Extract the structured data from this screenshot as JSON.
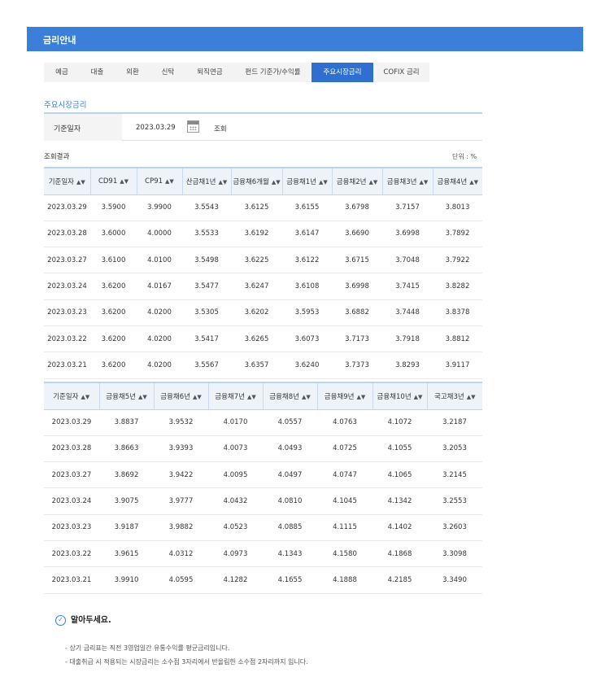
{
  "page": {
    "title": "금리안내"
  },
  "tabs": [
    {
      "label": "예금",
      "active": false
    },
    {
      "label": "대출",
      "active": false
    },
    {
      "label": "외환",
      "active": false
    },
    {
      "label": "신탁",
      "active": false
    },
    {
      "label": "퇴직연금",
      "active": false
    },
    {
      "label": "펀드 기준가/수익률",
      "active": false
    },
    {
      "label": "주요시장금리",
      "active": true
    },
    {
      "label": "COFIX 금리",
      "active": false
    }
  ],
  "section": {
    "title": "주요시장금리"
  },
  "search": {
    "label": "기준일자",
    "date": "2023.03.29",
    "button": "조회"
  },
  "result": {
    "label": "조회결과",
    "unit": "단위 : %"
  },
  "table1": {
    "headers": [
      "기준일자",
      "CD91",
      "CP91",
      "산금채1년",
      "금융채6개월",
      "금융채1년",
      "금융채2년",
      "금융채3년",
      "금융채4년"
    ],
    "rows": [
      [
        "2023.03.29",
        "3.5900",
        "3.9900",
        "3.5543",
        "3.6125",
        "3.6155",
        "3.6798",
        "3.7157",
        "3.8013"
      ],
      [
        "2023.03.28",
        "3.6000",
        "4.0000",
        "3.5533",
        "3.6192",
        "3.6147",
        "3.6690",
        "3.6998",
        "3.7892"
      ],
      [
        "2023.03.27",
        "3.6100",
        "4.0100",
        "3.5498",
        "3.6225",
        "3.6122",
        "3.6715",
        "3.7048",
        "3.7922"
      ],
      [
        "2023.03.24",
        "3.6200",
        "4.0167",
        "3.5477",
        "3.6247",
        "3.6108",
        "3.6998",
        "3.7415",
        "3.8282"
      ],
      [
        "2023.03.23",
        "3.6200",
        "4.0200",
        "3.5305",
        "3.6202",
        "3.5953",
        "3.6882",
        "3.7448",
        "3.8378"
      ],
      [
        "2023.03.22",
        "3.6200",
        "4.0200",
        "3.5417",
        "3.6265",
        "3.6073",
        "3.7173",
        "3.7918",
        "3.8812"
      ],
      [
        "2023.03.21",
        "3.6200",
        "4.0200",
        "3.5567",
        "3.6357",
        "3.6240",
        "3.7373",
        "3.8293",
        "3.9117"
      ]
    ]
  },
  "table2": {
    "headers": [
      "기준일자",
      "금융채5년",
      "금융채6년",
      "금융채7년",
      "금융채8년",
      "금융채9년",
      "금융채10년",
      "국고채3년"
    ],
    "rows": [
      [
        "2023.03.29",
        "3.8837",
        "3.9532",
        "4.0170",
        "4.0557",
        "4.0763",
        "4.1072",
        "3.2187"
      ],
      [
        "2023.03.28",
        "3.8663",
        "3.9393",
        "4.0073",
        "4.0493",
        "4.0725",
        "4.1055",
        "3.2053"
      ],
      [
        "2023.03.27",
        "3.8692",
        "3.9422",
        "4.0095",
        "4.0497",
        "4.0747",
        "4.1065",
        "3.2145"
      ],
      [
        "2023.03.24",
        "3.9075",
        "3.9777",
        "4.0432",
        "4.0810",
        "4.1045",
        "4.1342",
        "3.2553"
      ],
      [
        "2023.03.23",
        "3.9187",
        "3.9882",
        "4.0523",
        "4.0885",
        "4.1115",
        "4.1402",
        "3.2603"
      ],
      [
        "2023.03.22",
        "3.9615",
        "4.0312",
        "4.0973",
        "4.1343",
        "4.1580",
        "4.1868",
        "3.3098"
      ],
      [
        "2023.03.21",
        "3.9910",
        "4.0595",
        "4.1282",
        "4.1655",
        "4.1888",
        "4.2185",
        "3.3490"
      ]
    ]
  },
  "notice": {
    "title": "알아두세요.",
    "items": [
      "상기 금리표는 직전 3영업일간 유통수익률 평균금리입니다.",
      "대출취급 시 적용되는 시장금리는 소수점 3자리에서 반올림한 소수점 2자리까지 입니다."
    ]
  },
  "icons": {
    "sort": "sort-updown-icon",
    "calendar": "calendar-icon",
    "check": "check-circle-icon"
  },
  "colors": {
    "primary": "#3b7fd9",
    "active_tab": "#2f6fcf"
  }
}
